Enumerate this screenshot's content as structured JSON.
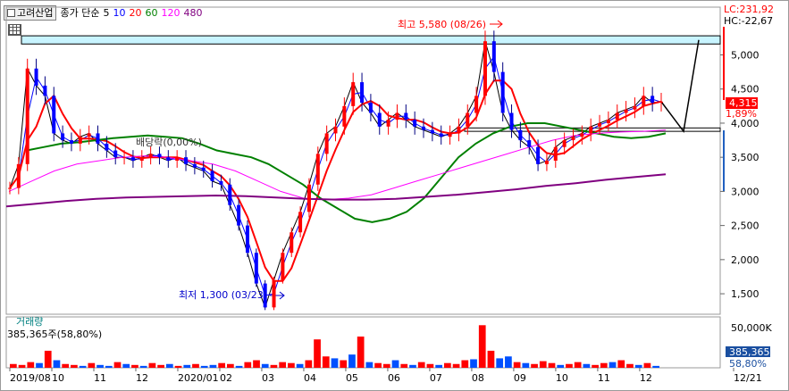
{
  "legend": {
    "ticker": "고려산업",
    "label": "종가 단순",
    "ma_periods": [
      "5",
      "10",
      "20",
      "60",
      "120",
      "480"
    ]
  },
  "right_info": {
    "lc": "LC:231,92",
    "hc": "HC:-22,67",
    "price_tag": "4,315",
    "pct_tag": "1,89%",
    "vol_tag": "385,365",
    "vol_pct_tag": "58,80%"
  },
  "annotations": {
    "high": "최고 5,580 (08/26)",
    "low": "최저 1,300 (03/23)",
    "dividend": "배당락(0,00%)"
  },
  "volume_panel": {
    "title": "거래량",
    "value": "385,365주(58,80%)"
  },
  "chart_data": {
    "type": "candlestick",
    "price_axis": {
      "ticks": [
        "5,000",
        "4,500",
        "4,000",
        "3,500",
        "3,000",
        "2,500",
        "2,000",
        "1,500"
      ],
      "values": [
        5000,
        4500,
        4000,
        3500,
        3000,
        2500,
        2000,
        1500
      ],
      "ylim": [
        1200,
        5700
      ]
    },
    "volume_axis": {
      "ticks": [
        "50,000K"
      ]
    },
    "x_labels": [
      "2019/08",
      "10",
      "11",
      "12",
      "2020/01",
      "02",
      "03",
      "04",
      "05",
      "06",
      "07",
      "08",
      "09",
      "10",
      "11",
      "12",
      "12/21"
    ],
    "close_series": [
      3050,
      3400,
      4800,
      4550,
      4400,
      3850,
      3750,
      3700,
      3800,
      3850,
      3700,
      3600,
      3500,
      3500,
      3450,
      3500,
      3550,
      3500,
      3450,
      3500,
      3400,
      3350,
      3300,
      3150,
      3100,
      2800,
      2500,
      2100,
      1650,
      1300,
      1700,
      2100,
      2400,
      2700,
      3100,
      3550,
      3850,
      3950,
      4250,
      4600,
      4300,
      4150,
      3950,
      4050,
      4150,
      4050,
      3950,
      3900,
      3850,
      3800,
      3850,
      3950,
      4150,
      4400,
      5200,
      4750,
      4150,
      3900,
      3750,
      3650,
      3400,
      3450,
      3650,
      3750,
      3800,
      3850,
      3950,
      4000,
      4050,
      4150,
      4200,
      4250,
      4400,
      4300,
      4315
    ],
    "moving_averages": [
      {
        "name": "5",
        "color": "#000000"
      },
      {
        "name": "10",
        "color": "#0000ff"
      },
      {
        "name": "20",
        "color": "#ff0000"
      },
      {
        "name": "60",
        "color": "#008000"
      },
      {
        "name": "120",
        "color": "#ff00ff"
      },
      {
        "name": "480",
        "color": "#800080"
      }
    ],
    "ma60_series": [
      3600,
      3650,
      3700,
      3720,
      3750,
      3780,
      3800,
      3820,
      3800,
      3780,
      3700,
      3600,
      3550,
      3500,
      3400,
      3250,
      3100,
      2900,
      2750,
      2600,
      2550,
      2600,
      2700,
      2900,
      3200,
      3500,
      3700,
      3850,
      3950,
      4000,
      4000,
      3950,
      3900,
      3850,
      3800,
      3780,
      3800,
      3850
    ],
    "ma120_series": [
      3000,
      3150,
      3300,
      3400,
      3450,
      3500,
      3520,
      3500,
      3450,
      3400,
      3300,
      3150,
      3000,
      2900,
      2880,
      2900,
      2950,
      3050,
      3150,
      3250,
      3350,
      3450,
      3550,
      3650,
      3750,
      3820,
      3850,
      3870,
      3880,
      3900
    ],
    "ma480_series": [
      2780,
      2820,
      2860,
      2890,
      2910,
      2920,
      2930,
      2940,
      2930,
      2910,
      2890,
      2880,
      2880,
      2890,
      2920,
      2950,
      2990,
      3030,
      3080,
      3120,
      3170,
      3210,
      3250
    ],
    "volume_values": [
      4,
      3,
      6,
      5,
      18,
      8,
      4,
      3,
      2,
      5,
      3,
      2,
      6,
      4,
      3,
      2,
      5,
      3,
      4,
      2,
      3,
      4,
      2,
      3,
      5,
      4,
      2,
      6,
      8,
      4,
      3,
      6,
      5,
      4,
      8,
      30,
      12,
      10,
      8,
      14,
      33,
      6,
      5,
      4,
      8,
      4,
      3,
      6,
      4,
      3,
      5,
      4,
      8,
      9,
      45,
      18,
      10,
      12,
      6,
      5,
      4,
      7,
      5,
      3,
      4,
      6,
      4,
      3,
      5,
      6,
      8,
      4,
      3,
      5,
      2
    ],
    "volume_colors_up": [
      true,
      true,
      true,
      false,
      true,
      false,
      true,
      true,
      false,
      true,
      false,
      false,
      true,
      false,
      true,
      false,
      true,
      true,
      false,
      true,
      false,
      true,
      false,
      false,
      true,
      true,
      false,
      true,
      true,
      false,
      true,
      true,
      true,
      false,
      true,
      true,
      true,
      false,
      true,
      false,
      true,
      false,
      true,
      true,
      false,
      true,
      false,
      true,
      true,
      false,
      true,
      true,
      true,
      false,
      true,
      true,
      false,
      false,
      true,
      false,
      true,
      true,
      true,
      false,
      true,
      true,
      false,
      true,
      true,
      false,
      true,
      true,
      false,
      true,
      false
    ],
    "highlight_band": {
      "upper": 5280,
      "lower": 5160
    },
    "support_band": {
      "upper": 3930,
      "lower": 3880
    }
  }
}
